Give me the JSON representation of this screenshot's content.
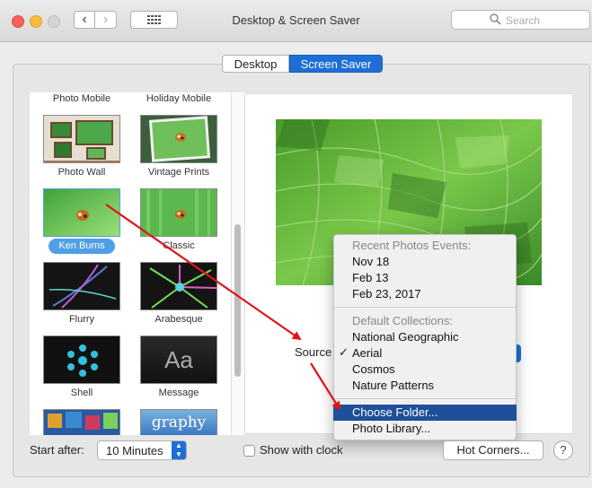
{
  "window": {
    "title": "Desktop & Screen Saver",
    "search_placeholder": "Search",
    "back_glyph": "‹",
    "forward_glyph": "›"
  },
  "tabs": [
    {
      "label": "Desktop",
      "selected": false
    },
    {
      "label": "Screen Saver",
      "selected": true
    }
  ],
  "savers": {
    "top_labels": [
      "Photo Mobile",
      "Holiday Mobile"
    ],
    "items": [
      {
        "label": "Photo Wall"
      },
      {
        "label": "Vintage Prints"
      },
      {
        "label": "Ken Burns",
        "selected": true
      },
      {
        "label": "Classic"
      },
      {
        "label": "Flurry"
      },
      {
        "label": "Arabesque"
      },
      {
        "label": "Shell"
      },
      {
        "label": "Message",
        "thumb_text": "Aa"
      },
      {
        "label": "",
        "thumb_text": " "
      },
      {
        "label": "",
        "thumb_text": "graphy"
      }
    ]
  },
  "source": {
    "label": "Source",
    "menu": {
      "recent_header": "Recent Photos Events:",
      "recent": [
        "Nov 18",
        "Feb 13",
        "Feb 23, 2017"
      ],
      "collections_header": "Default Collections:",
      "collections": [
        "National Geographic",
        "Aerial",
        "Cosmos",
        "Nature Patterns"
      ],
      "checked": "Aerial",
      "actions": [
        "Choose Folder...",
        "Photo Library..."
      ],
      "highlighted": "Choose Folder..."
    }
  },
  "bottom": {
    "start_after_label": "Start after:",
    "start_after_value": "10 Minutes",
    "show_clock_label": "Show with clock",
    "show_clock_checked": false,
    "hot_corners_label": "Hot Corners...",
    "help_label": "?"
  },
  "colors": {
    "accent": "#1d6fd6",
    "menu_highlight": "#1d4f9a",
    "annotation_arrow": "#e0141a"
  }
}
